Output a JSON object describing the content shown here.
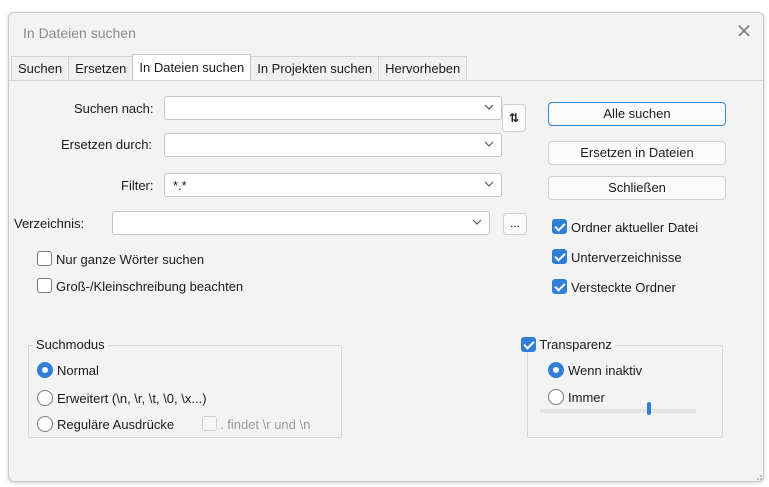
{
  "window": {
    "title": "In Dateien suchen"
  },
  "tabs": [
    "Suchen",
    "Ersetzen",
    "In Dateien suchen",
    "In Projekten suchen",
    "Hervorheben"
  ],
  "fields": {
    "find_label": "Suchen nach:",
    "find_value": "",
    "replace_label": "Ersetzen durch:",
    "replace_value": "",
    "filter_label": "Filter:",
    "filter_value": "*.*",
    "dir_label": "Verzeichnis:",
    "dir_value": "",
    "browse_label": "..."
  },
  "buttons": {
    "find_all": "Alle suchen",
    "replace_in_files": "Ersetzen in Dateien",
    "close": "Schließen"
  },
  "options": {
    "whole_words": {
      "label": "Nur ganze Wörter suchen",
      "checked": false
    },
    "match_case": {
      "label": "Groß-/Kleinschreibung beachten",
      "checked": false
    },
    "current_folder": {
      "label": "Ordner aktueller Datei",
      "checked": true
    },
    "subfolders": {
      "label": "Unterverzeichnisse",
      "checked": true
    },
    "hidden_folders": {
      "label": "Versteckte Ordner",
      "checked": true
    }
  },
  "search_mode": {
    "title": "Suchmodus",
    "normal": "Normal",
    "extended": "Erweitert (\\n, \\r, \\t, \\0, \\x...)",
    "regex": "Reguläre Ausdrücke",
    "dot_newline": ". findet \\r und \\n",
    "selected": "Normal"
  },
  "transparency": {
    "title": "Transparenz",
    "enabled": true,
    "when_inactive": "Wenn inaktiv",
    "always": "Immer",
    "selected": "Wenn inaktiv",
    "level": 0.7
  },
  "colors": {
    "accent": "#2f7fd6",
    "dialog_bg": "#f3f3f3"
  }
}
